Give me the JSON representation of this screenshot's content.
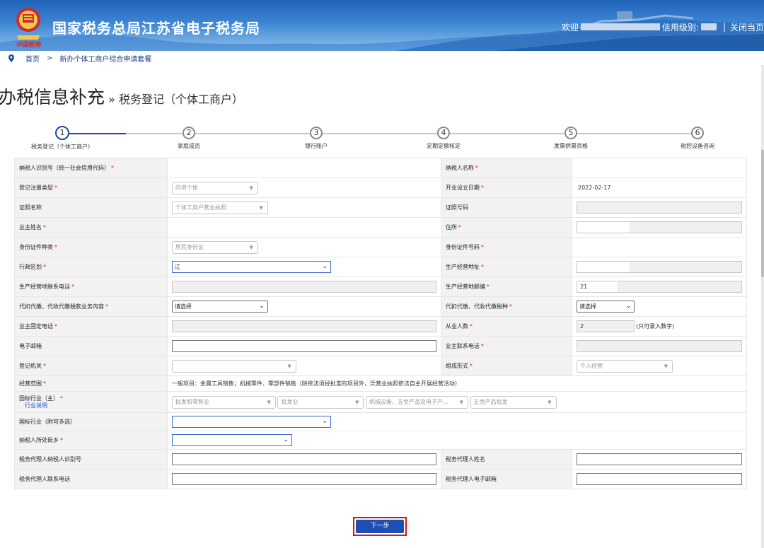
{
  "header": {
    "title": "国家税务总局江苏省电子税务局",
    "emblem_text": "中国税务",
    "welcome": "欢迎",
    "credit_label": "信用级别:",
    "sep": "|",
    "close_label": "关闭当页"
  },
  "breadcrumb": {
    "home": "首页",
    "arrow": ">",
    "current": "新办个体工商户综合申请套餐"
  },
  "page": {
    "title": "办税信息补充",
    "sep": "»",
    "subtitle": "税务登记（个体工商户）"
  },
  "steps": [
    {
      "num": "1",
      "label": "税务登记（个体工商户）",
      "active": true
    },
    {
      "num": "2",
      "label": "家庭成员",
      "active": false
    },
    {
      "num": "3",
      "label": "银行账户",
      "active": false
    },
    {
      "num": "4",
      "label": "定期定额核定",
      "active": false
    },
    {
      "num": "5",
      "label": "发票供票资格",
      "active": false
    },
    {
      "num": "6",
      "label": "税控设备咨询",
      "active": false
    }
  ],
  "form": {
    "req": "*",
    "taxpayer_id_label": "纳税人识别号（统一社会信用代码）",
    "taxpayer_name_label": "纳税人名称",
    "reg_type_label": "登记注册类型",
    "reg_type_value": "内资个体",
    "open_date_label": "开业设立日期",
    "open_date_value": "2022-02-17",
    "cert_name_label": "证照名称",
    "cert_name_value": "个体工商户营业执照",
    "cert_no_label": "证照号码",
    "owner_name_label": "业主姓名",
    "address_label": "住所",
    "id_type_label": "身份证件种类",
    "id_type_value": "居民身份证",
    "id_no_label": "身份证件号码",
    "region_label": "行政区划",
    "region_value": "江",
    "biz_addr_label": "生产经营地址",
    "biz_phone_label": "生产经营地联系电话",
    "biz_zip_label": "生产经营地邮编",
    "biz_zip_value": "21",
    "withhold_content_label": "代扣代缴、代收代缴税款业务内容",
    "withhold_content_value": "请选择",
    "withhold_tax_label": "代扣代缴、代收代缴税种",
    "withhold_tax_value": "请选择",
    "owner_phone_label": "业主固定电话",
    "employees_label": "从业人数",
    "employees_value": "2",
    "employees_note": "(只可录入数字)",
    "email_label": "电子邮箱",
    "owner_contact_label": "业主联系电话",
    "reg_authority_label": "登记机关",
    "org_form_label": "组成形式",
    "org_form_value": "个人经营",
    "biz_scope_label": "经营范围",
    "biz_scope_value": "一般项目：金属工具销售；机械零件、零部件销售（除依法须经批准的项目外，凭营业执照依法自主开展经营活动）",
    "industry_main_label": "国标行业（主）",
    "industry_desc_link": "行业说明",
    "industry_1": "批发和零售业",
    "industry_2": "批发业",
    "industry_3": "机械设备、五金产品及电子产...",
    "industry_4": "五金产品批发",
    "industry_extra_label": "国标行业（附可多选）",
    "street_label": "纳税人所处街乡",
    "agent_id_label": "税务代理人纳税人识别号",
    "agent_name_label": "税务代理人姓名",
    "agent_phone_label": "税务代理人联系电话",
    "agent_email_label": "税务代理人电子邮箱"
  },
  "buttons": {
    "next": "下一步"
  },
  "colors": {
    "primary": "#1d4fb4",
    "required": "#e02020",
    "header_top": "#1f62b8",
    "highlight": "#e01010"
  }
}
